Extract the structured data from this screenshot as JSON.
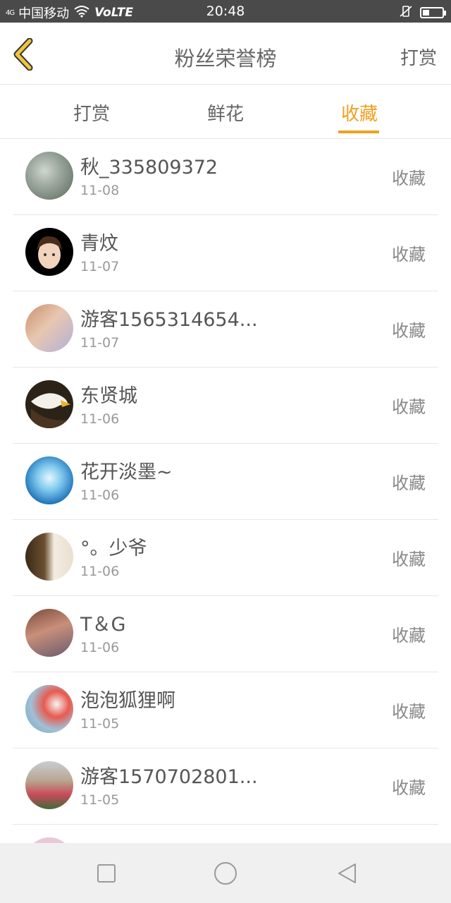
{
  "status": {
    "signal": "4G",
    "carrier": "中国移动",
    "volte": "VoLTE",
    "time": "20:48"
  },
  "header": {
    "title": "粉丝荣誉榜",
    "reward": "打赏"
  },
  "tabs": [
    {
      "label": "打赏",
      "active": false
    },
    {
      "label": "鲜花",
      "active": false
    },
    {
      "label": "收藏",
      "active": true
    }
  ],
  "colors": {
    "accent": "#f0a020"
  },
  "list": [
    {
      "name": "秋_335809372",
      "date": "11-08",
      "action": "收藏"
    },
    {
      "name": "青炆",
      "date": "11-07",
      "action": "收藏"
    },
    {
      "name": "游客1565314654...",
      "date": "11-07",
      "action": "收藏"
    },
    {
      "name": "东贤城",
      "date": "11-06",
      "action": "收藏"
    },
    {
      "name": "花开淡墨~",
      "date": "11-06",
      "action": "收藏"
    },
    {
      "name": "°。少爷",
      "date": "11-06",
      "action": "收藏"
    },
    {
      "name": "T＆G",
      "date": "11-06",
      "action": "收藏"
    },
    {
      "name": "泡泡狐狸啊",
      "date": "11-05",
      "action": "收藏"
    },
    {
      "name": "游客1570702801...",
      "date": "11-05",
      "action": "收藏"
    }
  ]
}
